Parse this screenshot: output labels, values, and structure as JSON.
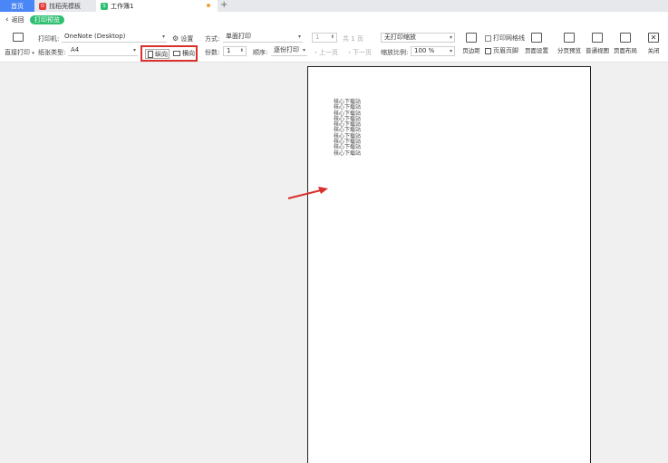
{
  "tabs": [
    {
      "label": "首页"
    },
    {
      "label": "找稻壳模板"
    },
    {
      "label": "工作簿1"
    }
  ],
  "new_tab": "+",
  "nav": {
    "back_label": "返回",
    "mode_pill": "打印预览"
  },
  "toolbar": {
    "direct_print": "直接打印",
    "printer_label": "打印机:",
    "printer_value": "OneNote (Desktop)",
    "settings_label": "设置",
    "method_label": "方式:",
    "method_value": "单面打印",
    "paper_type_label": "纸张类型:",
    "paper_type_value": "A4",
    "portrait_label": "纵向",
    "landscape_label": "横向",
    "copies_label": "份数:",
    "copies_value": "1",
    "order_label": "顺序:",
    "order_value": "逐份打印",
    "page_current": "1",
    "page_total": "共 1 页",
    "prev_page": "上一页",
    "next_page": "下一页",
    "scale_select": "无打印缩放",
    "scale_label": "缩放比例:",
    "scale_value": "100 %",
    "margins": "页边距",
    "print_gridlines": "打印网格线",
    "header_footer": "页眉页脚",
    "page_setup": "页面设置",
    "page_break_preview": "分页预览",
    "normal_view": "普通视图",
    "page_layout": "页面布局",
    "close": "关闭"
  },
  "preview_lines": [
    "核心下载站",
    "核心下载站",
    "核心下载站",
    "核心下载站",
    "核心下载站",
    "核心下载站",
    "核心下载站",
    "核心下载站",
    "核心下载站",
    "核心下载站"
  ],
  "colors": {
    "accent_blue": "#4a86f5",
    "pill_green": "#2fbf71",
    "highlight_red": "#d8312d"
  }
}
